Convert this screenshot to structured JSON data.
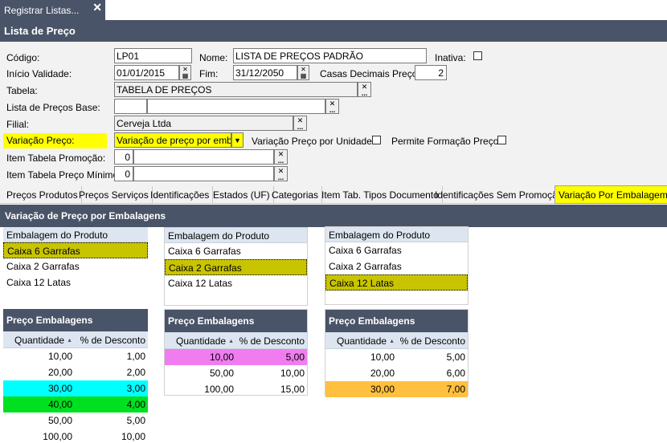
{
  "window_tab": {
    "title": "Registrar Listas...",
    "close": "✕"
  },
  "title": "Lista de Preço",
  "form": {
    "codigo_label": "Código:",
    "codigo": "LP01",
    "nome_label": "Nome:",
    "nome": "LISTA DE PREÇOS PADRÃO",
    "inativa_label": "Inativa:",
    "inicio_label": "Início Validade:",
    "inicio": "01/01/2015",
    "fim_label": "Fim:",
    "fim": "31/12/2050",
    "casas_label": "Casas Decimais Preço:",
    "casas": "2",
    "tabela_label": "Tabela:",
    "tabela": "TABELA DE PREÇOS",
    "base_label": "Lista de Preços Base:",
    "filial_label": "Filial:",
    "filial": "Cerveja Ltda",
    "variacao_label": "Variação Preço:",
    "variacao": "Variação de preço por embala",
    "var_unidade_label": "Variação Preço por Unidade:",
    "permite_label": "Permite Formação Preço:",
    "promo_label": "Item Tabela Promoção:",
    "promo": "0",
    "minimo_label": "Item Tabela Preço Mínimo:",
    "minimo": "0"
  },
  "tabs": [
    "Preços Produtos",
    "Preços Serviços",
    "Identificações",
    "Estados (UF)",
    "Categorias",
    "Item Tab. Tipos Documento",
    "Identificações Sem Promoção",
    "Variação Por Embalagem"
  ],
  "section_title": "Variação de Preço por Embalagens",
  "emb_header": "Embalagem do Produto",
  "emb_items": [
    "Caixa 6 Garrafas",
    "Caixa 2 Garrafas",
    "Caixa 12 Latas"
  ],
  "preco_title": "Preço Embalagens",
  "col_qtd": "Quantidade",
  "col_desc": "% de Desconto",
  "precos1": [
    {
      "q": "10,00",
      "d": "1,00"
    },
    {
      "q": "20,00",
      "d": "2,00"
    },
    {
      "q": "30,00",
      "d": "3,00"
    },
    {
      "q": "40,00",
      "d": "4,00"
    },
    {
      "q": "50,00",
      "d": "5,00"
    },
    {
      "q": "100,00",
      "d": "10,00"
    }
  ],
  "precos2": [
    {
      "q": "10,00",
      "d": "5,00"
    },
    {
      "q": "50,00",
      "d": "10,00"
    },
    {
      "q": "100,00",
      "d": "15,00"
    }
  ],
  "precos3": [
    {
      "q": "10,00",
      "d": "5,00"
    },
    {
      "q": "20,00",
      "d": "6,00"
    },
    {
      "q": "30,00",
      "d": "7,00"
    }
  ],
  "colors": {
    "header_bg": "#4a5468",
    "selected_row": "#c8c400",
    "cyan": "#00ffff",
    "green": "#00e020",
    "pink": "#f07cf0",
    "orange": "#ffc040"
  }
}
